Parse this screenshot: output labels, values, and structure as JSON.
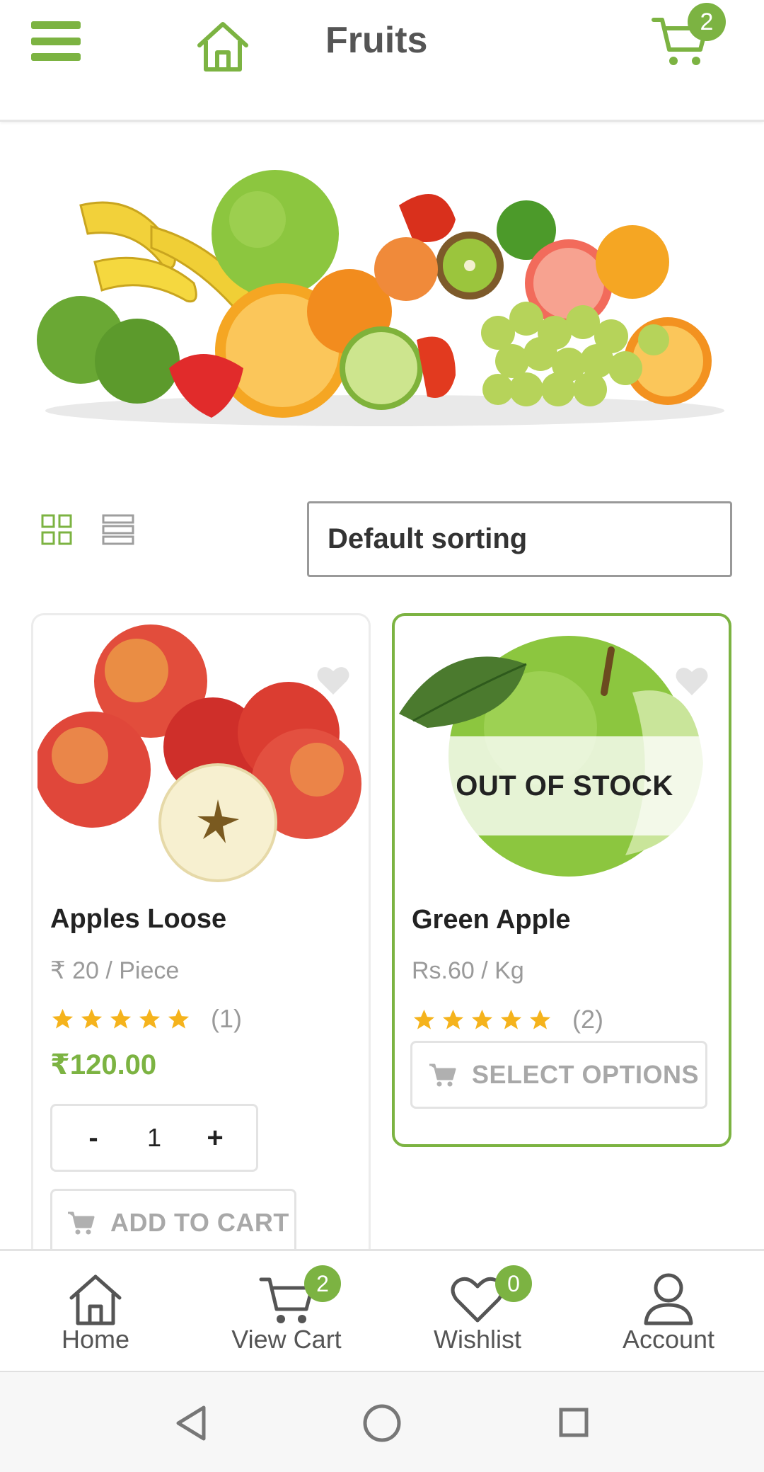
{
  "header": {
    "title": "Fruits",
    "cart_count": "2"
  },
  "toolbar": {
    "sort_label": "Default sorting"
  },
  "products": [
    {
      "name": "Apples Loose",
      "unit": "₹ 20 / Piece",
      "rating_count": "(1)",
      "stars": 5,
      "price": "₹120.00",
      "quantity": "1",
      "qty_minus": "-",
      "qty_plus": "+",
      "button": "ADD TO CART"
    },
    {
      "name": "Green Apple",
      "unit": "Rs.60 / Kg",
      "rating_count": "(2)",
      "stars": 5,
      "badge": "OUT OF STOCK",
      "button": "SELECT OPTIONS"
    }
  ],
  "bottom_nav": {
    "items": [
      {
        "label": "Home",
        "icon": "home-icon"
      },
      {
        "label": "View Cart",
        "icon": "cart-icon",
        "badge": "2"
      },
      {
        "label": "Wishlist",
        "icon": "heart-icon",
        "badge": "0"
      },
      {
        "label": "Account",
        "icon": "account-icon"
      }
    ]
  },
  "colors": {
    "accent": "#7cb342",
    "star": "#f5b31c",
    "muted_text": "#9a9a9a"
  }
}
